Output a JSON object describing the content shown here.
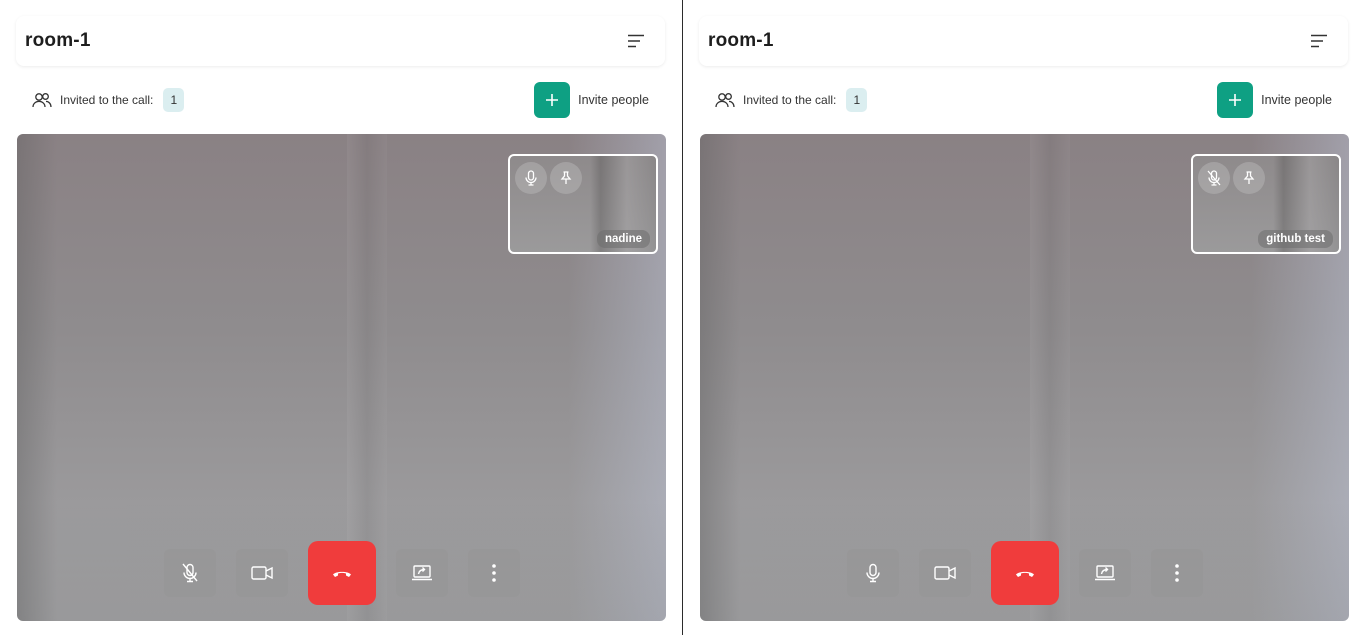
{
  "panes": [
    {
      "room_title": "room-1",
      "invited_label": "Invited to the call:",
      "invited_count": "1",
      "invite_label": "Invite people",
      "participant_name": "nadine",
      "participant_mic": "muted-mic-icon",
      "local_mic": "muted"
    },
    {
      "room_title": "room-1",
      "invited_label": "Invited to the call:",
      "invited_count": "1",
      "invite_label": "Invite people",
      "participant_name": "github test",
      "participant_mic": "muted-mic-icon",
      "local_mic": "unmuted"
    }
  ],
  "colors": {
    "accent": "#0ea083",
    "hangup": "#f03c3c",
    "badge_bg": "#dbeef0"
  }
}
